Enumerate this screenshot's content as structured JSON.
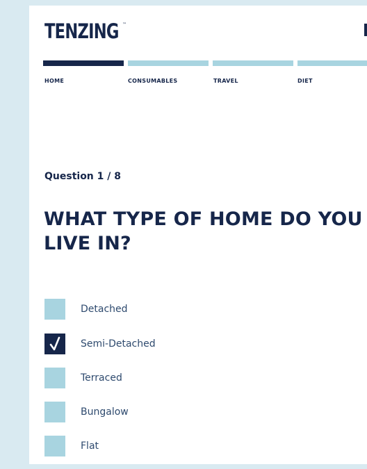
{
  "brand": {
    "logo_text": "TENZING",
    "logo_mark": "™"
  },
  "nav": {
    "steps": [
      {
        "label": "HOME",
        "active": true
      },
      {
        "label": "CONSUMABLES",
        "active": false
      },
      {
        "label": "TRAVEL",
        "active": false
      },
      {
        "label": "DIET",
        "active": false
      }
    ]
  },
  "question": {
    "counter": "Question 1 / 8",
    "title_line1": "WHAT TYPE OF HOME DO YOU",
    "title_line2": "LIVE IN?"
  },
  "options": [
    {
      "label": "Detached",
      "checked": false
    },
    {
      "label": "Semi-Detached",
      "checked": true
    },
    {
      "label": "Terraced",
      "checked": false
    },
    {
      "label": "Bungalow",
      "checked": false
    },
    {
      "label": "Flat",
      "checked": false
    }
  ],
  "colors": {
    "navy": "#16264a",
    "light_blue": "#a8d4e0",
    "background": "#d9eaf1"
  }
}
